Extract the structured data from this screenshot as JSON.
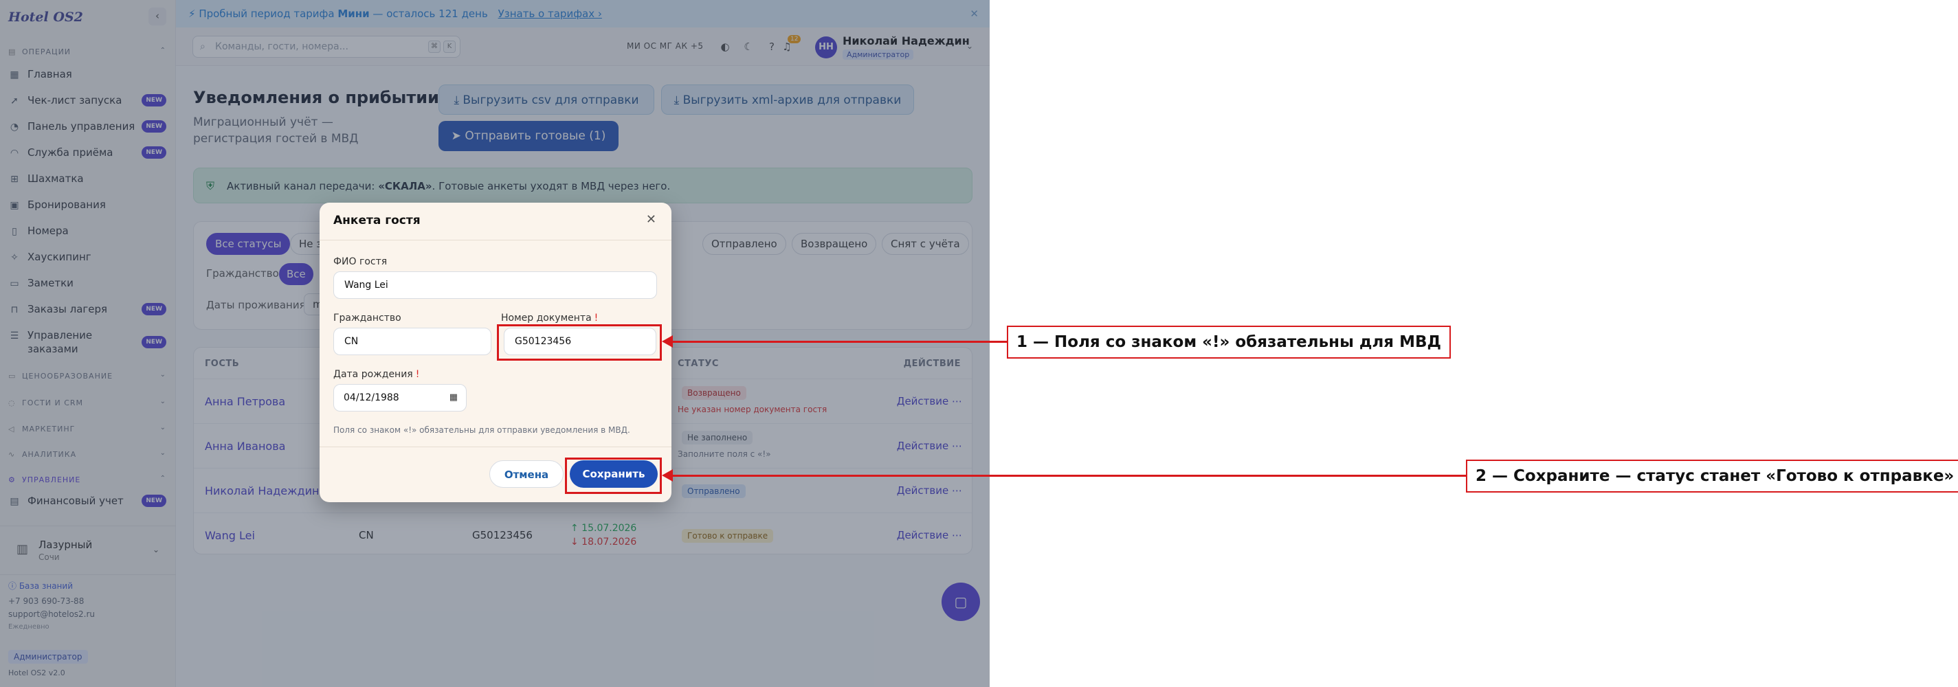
{
  "app": {
    "logo": "Hotel OS2"
  },
  "promo": {
    "prefix": "Пробный период тарифа",
    "plan": "Мини",
    "suffix": "— осталось 121 день",
    "link": "Узнать о тарифах ›",
    "close": "✕"
  },
  "search": {
    "placeholder": "Команды, гости, номера...",
    "kbd1": "⌘",
    "kbd2": "K"
  },
  "presence": "МИ ОС МГ АК +5",
  "notifications_count": "12",
  "user": {
    "initials": "НН",
    "name": "Николай Надеждин",
    "role": "Администратор"
  },
  "sidebar": {
    "section_operations": "Операции",
    "items": [
      {
        "label": "Главная",
        "icon": "grid-icon",
        "new": false
      },
      {
        "label": "Чек-лист запуска",
        "icon": "rocket-icon",
        "new": true
      },
      {
        "label": "Панель управления",
        "icon": "gauge-icon",
        "new": true
      },
      {
        "label": "Служба приёма",
        "icon": "bell-icon",
        "new": true
      },
      {
        "label": "Шахматка",
        "icon": "table-icon",
        "new": false
      },
      {
        "label": "Бронирования",
        "icon": "calendar-icon",
        "new": false
      },
      {
        "label": "Номера",
        "icon": "door-icon",
        "new": false
      },
      {
        "label": "Хаускипинг",
        "icon": "sparkle-icon",
        "new": false
      },
      {
        "label": "Заметки",
        "icon": "note-icon",
        "new": false
      },
      {
        "label": "Заказы лагеря",
        "icon": "bag-icon",
        "new": true
      },
      {
        "label": "Управление заказами",
        "icon": "list-icon",
        "new": true
      }
    ],
    "new_label": "NEW",
    "section_pricing": "Ценообразование",
    "section_guests": "Гости и CRM",
    "section_marketing": "Маркетинг",
    "section_analytics": "Аналитика",
    "section_management": "Управление",
    "finance_label": "Финансовый учет",
    "property_name": "Лазурный",
    "property_city": "Сочи",
    "kb_link": "База знаний",
    "phone": "+7 903 690-73-88",
    "email": "support@hotelos2.ru",
    "schedule": "Ежедневно",
    "role_badge": "Администратор",
    "version": "Hotel OS2 v2.0"
  },
  "page": {
    "title": "Уведомления о прибытии",
    "subtitle": "Миграционный учёт — регистрация гостей в МВД",
    "btn_csv": "Выгрузить csv для отправки",
    "btn_xml": "Выгрузить xml-архив для отправки",
    "btn_send": "Отправить готовые (1)",
    "banner_prefix": "Активный канал передачи:",
    "banner_channel": "«СКАЛА»",
    "banner_suffix": ". Готовые анкеты уходят в МВД через него."
  },
  "filters": {
    "status_chips": [
      "Все статусы",
      "Не з",
      "но",
      "Отправлено",
      "Возвращено",
      "Снят с учёта"
    ],
    "citizenship_label": "Гражданство:",
    "citizenship_active": "Все",
    "dates_label": "Даты проживания:",
    "dates_value": "m"
  },
  "table": {
    "headers": {
      "guest": "Гость",
      "status": "Статус",
      "action": "Действие"
    },
    "rows": [
      {
        "name": "Анна Петрова",
        "status": "Возвращено",
        "note": "Не указан номер документа гостя",
        "action": "Действие ⋯"
      },
      {
        "name": "Анна Иванова",
        "status": "Не заполнено",
        "note": "Заполните поля с «!»",
        "action": "Действие ⋯"
      },
      {
        "name": "Николай Надеждин",
        "status": "Отправлено",
        "note": "",
        "action": "Действие ⋯"
      },
      {
        "name": "Wang Lei",
        "citizenship": "CN",
        "doc": "G50123456",
        "arrival": "↑ 15.07.2026",
        "departure": "↓ 18.07.2026",
        "status": "Готово к отправке",
        "note": "",
        "action": "Действие ⋯"
      }
    ]
  },
  "modal": {
    "title": "Анкета гостя",
    "fio_label": "ФИО гостя",
    "fio_value": "Wang Lei",
    "citizenship_label": "Гражданство",
    "citizenship_value": "CN",
    "doc_label": "Номер документа",
    "doc_value": "G50123456",
    "birth_label": "Дата рождения",
    "birth_value": "04/12/1988",
    "required_mark": "!",
    "hint": "Поля со знаком «!» обязательны для отправки уведомления в МВД.",
    "cancel": "Отмена",
    "save": "Сохранить"
  },
  "callouts": {
    "one": "1 — Поля со знаком «!» обязательны для МВД",
    "two": "2 — Сохраните — статус станет «Готово к отправке»"
  },
  "colors": {
    "accent": "#4f3bd6",
    "primary_button": "#1f4fb6",
    "callout_red": "#d7191c"
  }
}
